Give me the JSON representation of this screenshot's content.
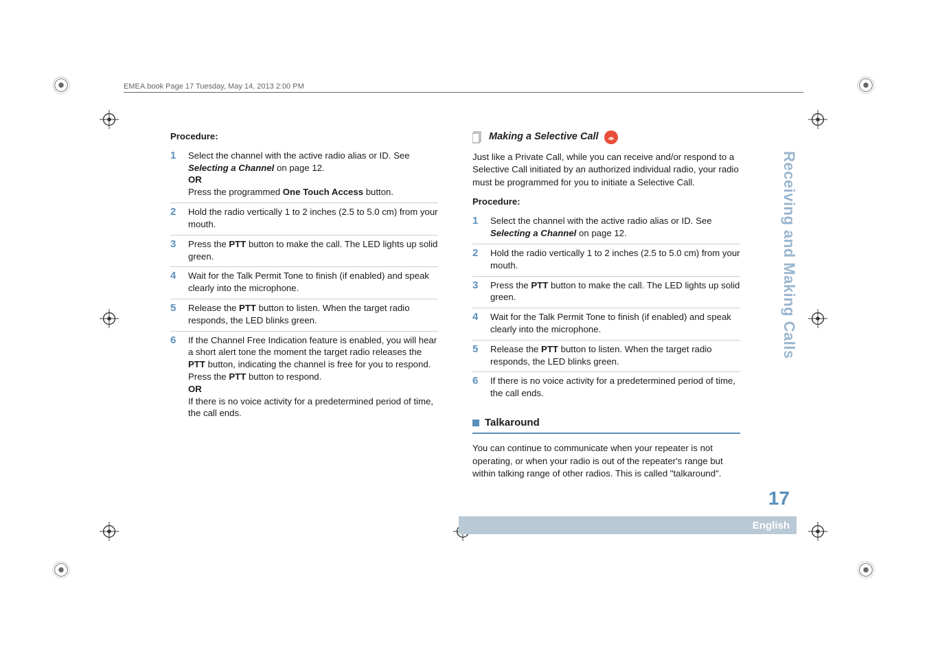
{
  "header_note": "EMEA.book  Page 17  Tuesday, May 14, 2013  2:00 PM",
  "left": {
    "proc_label": "Procedure:",
    "steps": [
      {
        "num": "1",
        "html": "Select the channel with the active radio alias or ID. See <span class='bi'>Selecting a Channel</span> on page 12.<br><span class='b'>OR</span><br>Press the programmed <span class='b'>One Touch Access</span> button."
      },
      {
        "num": "2",
        "html": "Hold the radio vertically 1 to 2 inches (2.5 to 5.0 cm) from your mouth."
      },
      {
        "num": "3",
        "html": "Press the <span class='b'>PTT</span> button to make the call. The LED lights up solid green."
      },
      {
        "num": "4",
        "html": "Wait for the Talk Permit Tone to finish (if enabled) and speak clearly into the microphone."
      },
      {
        "num": "5",
        "html": "Release the <span class='b'>PTT</span> button to listen. When the target radio responds, the LED blinks green."
      },
      {
        "num": "6",
        "html": "If the Channel Free Indication feature is enabled, you will hear a short alert tone the moment the target radio releases the <span class='b'>PTT</span> button, indicating the channel is free for you to respond. Press the <span class='b'>PTT</span> button to respond.<br><span class='b'>OR</span><br>If there is no voice activity for a predetermined period of time, the call ends."
      }
    ]
  },
  "right": {
    "heading": "Making a Selective Call",
    "intro": "Just like a Private Call, while you can receive and/or respond to a Selective Call initiated by an authorized individual radio, your radio must be programmed for you to initiate a Selective Call.",
    "proc_label": "Procedure:",
    "steps": [
      {
        "num": "1",
        "html": "Select the channel with the active radio alias or ID. See <span class='bi'>Selecting a Channel</span> on page 12."
      },
      {
        "num": "2",
        "html": "Hold the radio vertically 1 to 2 inches (2.5 to 5.0 cm) from your mouth."
      },
      {
        "num": "3",
        "html": "Press the <span class='b'>PTT</span> button to make the call. The LED lights up solid green."
      },
      {
        "num": "4",
        "html": "Wait for the Talk Permit Tone to finish (if enabled) and speak clearly into the microphone."
      },
      {
        "num": "5",
        "html": "Release the <span class='b'>PTT</span> button to listen. When the target radio responds, the LED blinks green."
      },
      {
        "num": "6",
        "html": "If there is no voice activity for a predetermined period of time, the call ends."
      }
    ],
    "section_title": "Talkaround",
    "section_body": "You can continue to communicate when your repeater is not operating, or when your radio is out of the repeater's range but within talking range of other radios. This is called \"talkaround\"."
  },
  "side_tab": "Receiving and Making Calls",
  "page_number": "17",
  "language": "English"
}
